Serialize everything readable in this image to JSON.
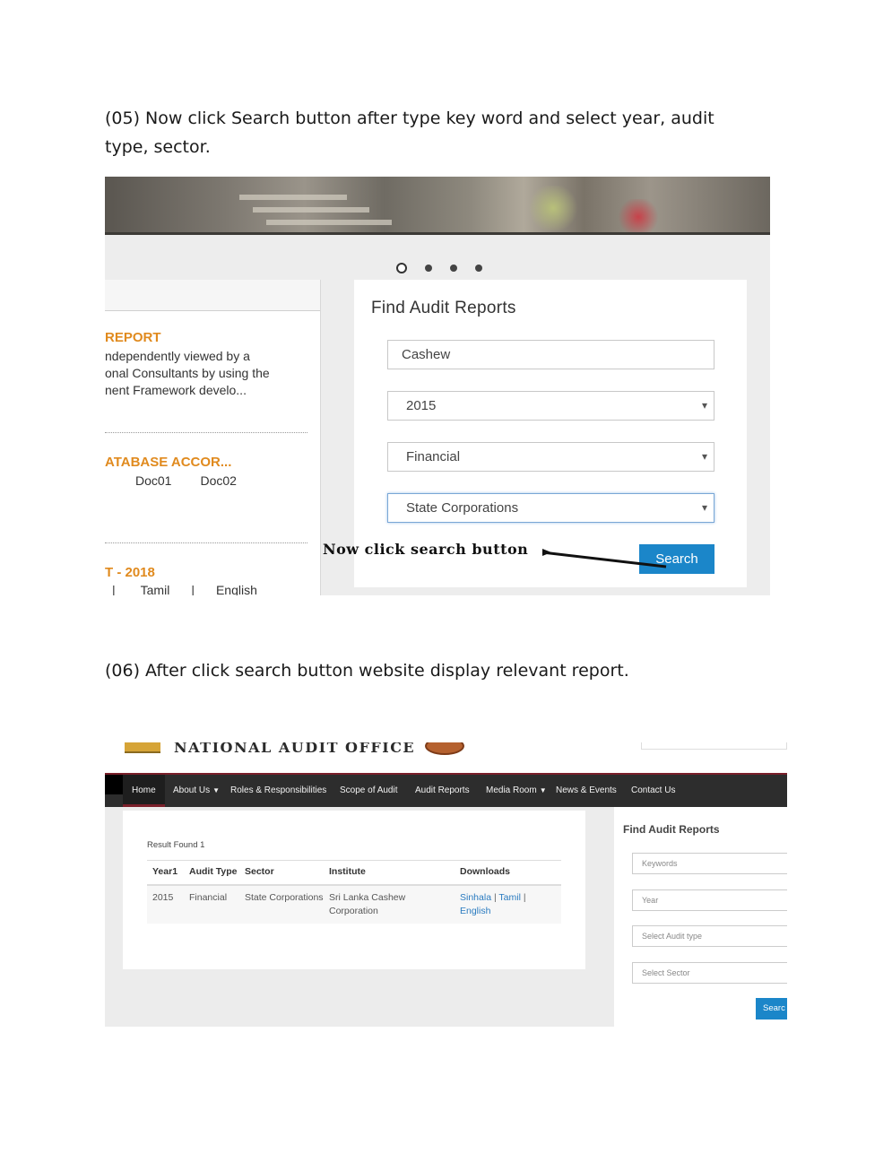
{
  "step5": {
    "text": "(05) Now click Search button after type key word and select year, audit type, sector."
  },
  "step6": {
    "text": "(06) After click search button website display relevant report."
  },
  "shot1": {
    "left_panel": {
      "item1_title": "REPORT",
      "item1_lines": [
        "ndependently viewed by a",
        "onal Consultants by using the",
        "nent Framework develo..."
      ],
      "item2_title": "ATABASE ACCOR...",
      "item2_links": [
        "Doc01",
        "Doc02"
      ],
      "item3_title": "T - 2018",
      "item3_links": [
        "|",
        "Tamil",
        "|",
        "English"
      ]
    },
    "find": {
      "heading": "Find Audit Reports",
      "keyword_value": "Cashew",
      "year_value": "2015",
      "audit_type_value": "Financial",
      "sector_value": "State Corporations",
      "search_label": "Search"
    },
    "annotation": "Now click search button"
  },
  "shot2": {
    "site_title": "NATIONAL AUDIT OFFICE",
    "nav": [
      "Home",
      "About Us",
      "Roles & Responsibilities",
      "Scope of Audit",
      "Audit Reports",
      "Media Room",
      "News & Events",
      "Contact Us"
    ],
    "result_count": "Result Found 1",
    "table": {
      "headers": [
        "Year1",
        "Audit Type",
        "Sector",
        "Institute",
        "Downloads"
      ],
      "row": {
        "year": "2015",
        "audit_type": "Financial",
        "sector": "State Corporations",
        "institute": "Sri Lanka Cashew Corporation",
        "downloads": [
          "Sinhala",
          "Tamil",
          "English"
        ]
      }
    },
    "side": {
      "heading": "Find Audit Reports",
      "keywords_placeholder": "Keywords",
      "year_placeholder": "Year",
      "audit_type_placeholder": "Select Audit type",
      "sector_placeholder": "Select Sector",
      "search_label": "Searc"
    }
  }
}
